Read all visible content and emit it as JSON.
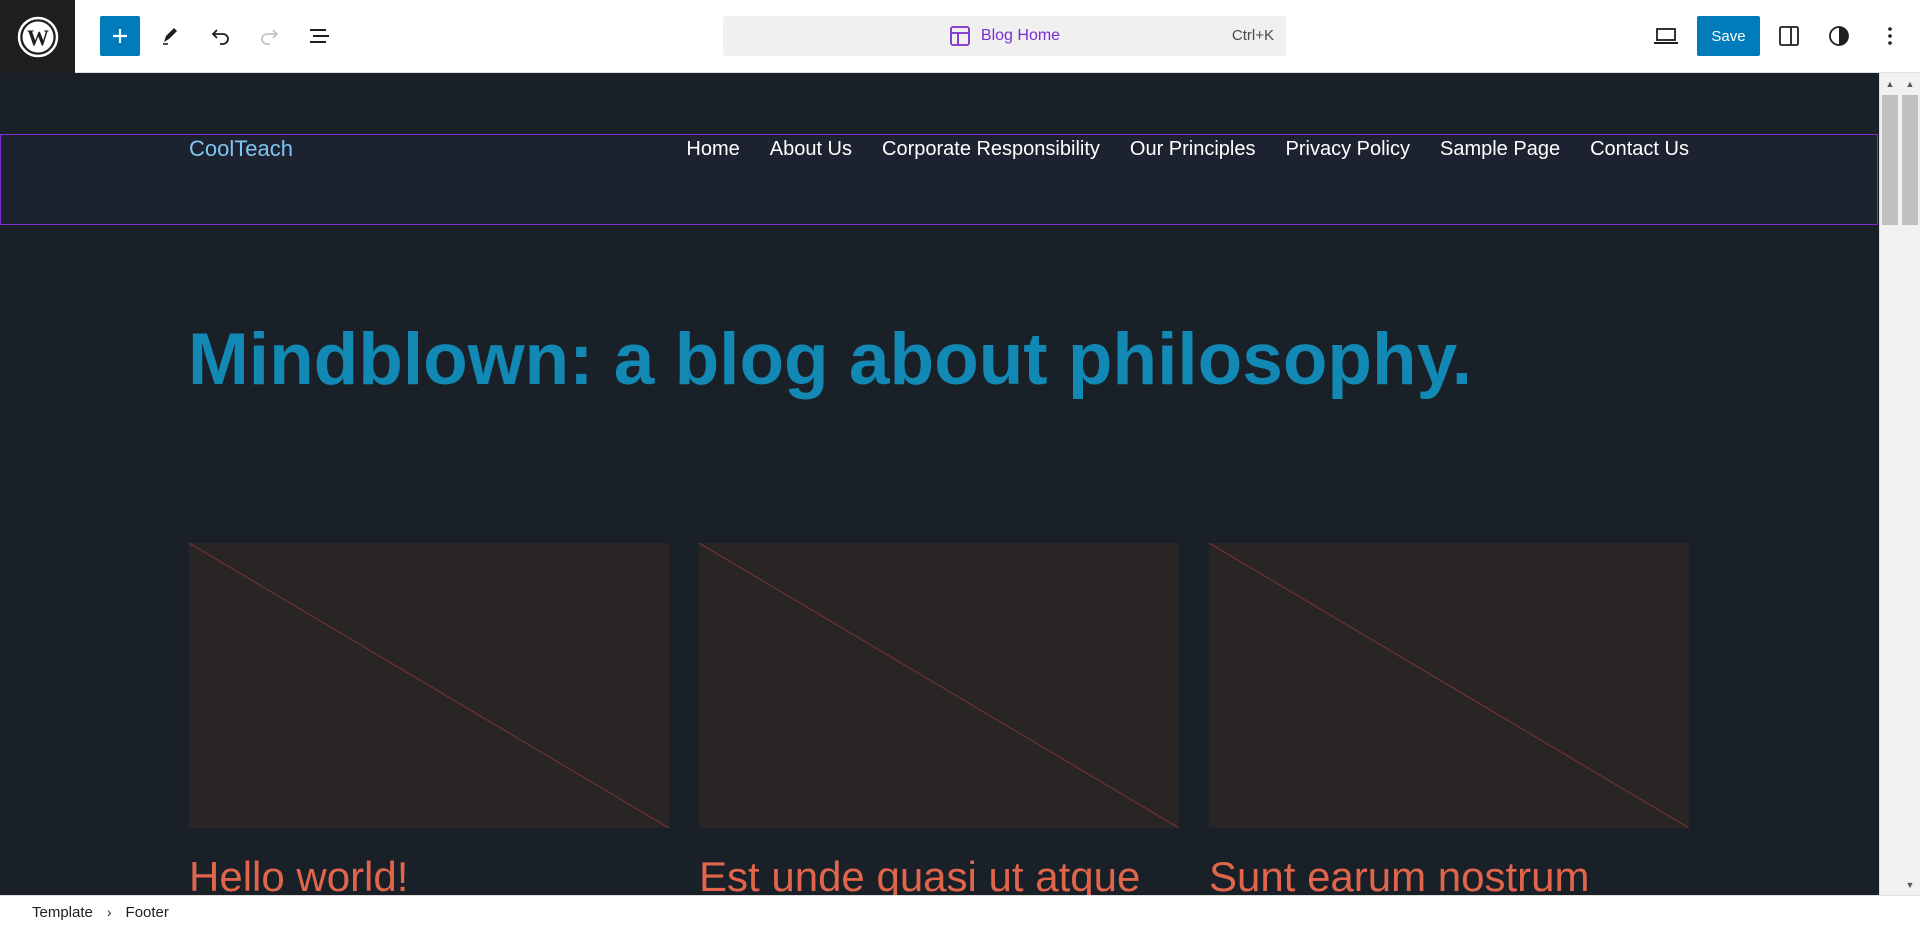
{
  "toolbar": {
    "add_block": "plus-icon",
    "tools": "pencil-icon",
    "undo": "undo-icon",
    "redo": "redo-icon",
    "list_view": "list-view-icon",
    "command_bar": {
      "title": "Blog Home",
      "shortcut": "Ctrl+K"
    },
    "view": "laptop-icon",
    "save_label": "Save",
    "settings": "sidebar-icon",
    "styles": "contrast-icon",
    "options": "more-vertical-icon"
  },
  "site": {
    "title": "CoolTeach",
    "nav": [
      "Home",
      "About Us",
      "Corporate Responsibility",
      "Our Principles",
      "Privacy Policy",
      "Sample Page",
      "Contact Us"
    ]
  },
  "hero": {
    "heading": "Mindblown: a blog about philosophy."
  },
  "posts": [
    {
      "title": "Hello world!"
    },
    {
      "title": "Est unde quasi ut atque"
    },
    {
      "title": "Sunt earum nostrum"
    }
  ],
  "breadcrumb": {
    "items": [
      "Template",
      "Footer"
    ]
  },
  "colors": {
    "canvas_bg": "#1a2027",
    "accent": "#007cba",
    "selection": "#7a2ed1",
    "hero": "#1288b4",
    "post_title": "#e0654a",
    "site_title": "#7fc6f0"
  }
}
